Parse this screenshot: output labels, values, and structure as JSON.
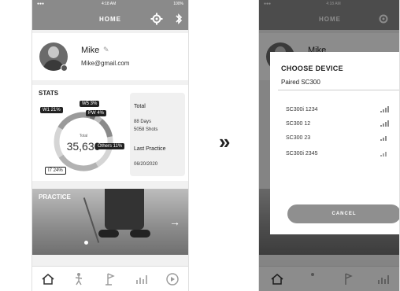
{
  "left_screen": {
    "status": {
      "time": "4:18 AM",
      "battery": "100%"
    },
    "header": {
      "title": "HOME"
    },
    "profile": {
      "name": "Mike",
      "email": "Mike@gmail.com"
    },
    "stats": {
      "header": "STATS",
      "center_label": "Total",
      "center_value": "35,630",
      "segments": [
        {
          "name": "W1",
          "percent": 21
        },
        {
          "name": "W5",
          "percent": 3
        },
        {
          "name": "PW",
          "percent": 4
        },
        {
          "name": "Others",
          "percent": 11
        },
        {
          "name": "I7",
          "percent": 24
        }
      ],
      "tags": {
        "w1": "W1 21%",
        "w5": "W5 3%",
        "pw": "PW 4%",
        "others": "Others 11%",
        "i7": "I7 24%"
      },
      "card": {
        "total_label": "Total",
        "days": "88 Days",
        "shots": "5058 Shots",
        "last_practice_label": "Last Practice",
        "last_practice_date": "06/20/2020"
      }
    },
    "practice": {
      "label": "PRACTICE"
    },
    "tabs": [
      "home-icon",
      "golfer-icon",
      "flag-icon",
      "chart-icon",
      "play-icon"
    ]
  },
  "separator": "»",
  "right_screen": {
    "status": {
      "time": "4:18 AM"
    },
    "header": {
      "title": "HOME"
    },
    "profile": {
      "name": "Mike"
    },
    "modal": {
      "title": "CHOOSE DEVICE",
      "paired": "Paired SC300",
      "devices": [
        "SC300i 1234",
        "SC300 12",
        "SC300 23",
        "SC300i 2345"
      ],
      "cancel_label": "CANCEL"
    }
  },
  "colors": {
    "header_bg": "#8a8a8a",
    "accent": "#222222",
    "cancel_bg": "#8f8f8f"
  }
}
